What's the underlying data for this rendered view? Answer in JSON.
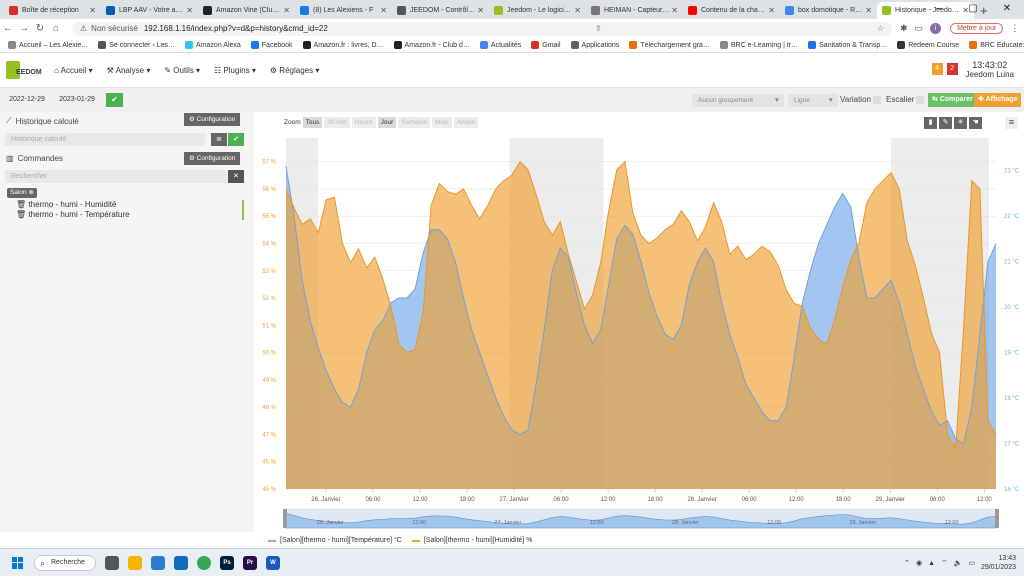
{
  "browser": {
    "tabs": [
      {
        "label": "Boîte de réception",
        "color": "#d93025"
      },
      {
        "label": "LBP AAV - Votre a…",
        "color": "#005eb8"
      },
      {
        "label": "Amazon Vine (Clu…",
        "color": "#222222"
      },
      {
        "label": "(8) Les Alexiens - F",
        "color": "#1877f2"
      },
      {
        "label": "JEEDOM - Contrôl…",
        "color": "#555555"
      },
      {
        "label": "Jeedom - Le logici…",
        "color": "#94c11f"
      },
      {
        "label": "HEIMAN - Capteur…",
        "color": "#777777"
      },
      {
        "label": "Contenu de la cha…",
        "color": "#ff0000"
      },
      {
        "label": "box domotique - R…",
        "color": "#4285f4"
      },
      {
        "label": "Historique - Jeedo…",
        "color": "#94c11f",
        "active": true
      }
    ],
    "address": {
      "warning": "Non sécurisé",
      "url": "192.168.1.16/index.php?v=d&p=history&cmd_id=22"
    },
    "update_label": "Mettre à jour",
    "profile_initial": "i",
    "bookmarks": [
      {
        "label": "Accueil – Les Alexie…",
        "color": "#888888"
      },
      {
        "label": "Se connecter ‹ Les…",
        "color": "#555555"
      },
      {
        "label": "Amazon Alexa",
        "color": "#31c4f3"
      },
      {
        "label": "Facebook",
        "color": "#1877f2"
      },
      {
        "label": "Amazon.fr : livres, D…",
        "color": "#222222"
      },
      {
        "label": "Amazon.fr - Club d…",
        "color": "#222222"
      },
      {
        "label": "Actualités",
        "color": "#4285f4"
      },
      {
        "label": "Gmail",
        "color": "#d93025"
      },
      {
        "label": "Applications",
        "color": "#5f6368"
      },
      {
        "label": "Téléchargement gra…",
        "color": "#e8710a"
      },
      {
        "label": "BRC e-Learning | tr…",
        "color": "#888888"
      },
      {
        "label": "Sanitation & Transp…",
        "color": "#1a73e8"
      },
      {
        "label": "Redeem Course",
        "color": "#333333"
      },
      {
        "label": "BRC Educate: Log in…",
        "color": "#e8710a"
      }
    ]
  },
  "jeedom": {
    "logo_text": "EEDOM",
    "menu": [
      "Accueil",
      "Analyse",
      "Outils",
      "Plugins",
      "Réglages"
    ],
    "badges": [
      {
        "value": "4",
        "color": "#f0a030"
      },
      {
        "value": "2",
        "color": "#d9342b"
      }
    ],
    "time": "13:43:02",
    "name": "Jeedom Luna"
  },
  "toolbar": {
    "date_start": "2022-12-29",
    "date_end": "2023-01-29",
    "grouping": "Aucun groupement",
    "line": "Ligne",
    "variation": "Variation",
    "escalier": "Escalier",
    "compare": "Comparer",
    "affichage": "Affichage"
  },
  "sidebar": {
    "calc_title": "Historique calculé",
    "calc_placeholder": "Historique calculé",
    "config_label": "Configuration",
    "commands_title": "Commandes",
    "search_placeholder": "Rechercher",
    "group": "Salon",
    "commands": [
      "thermo - humi - Humidité",
      "thermo - humi - Température"
    ]
  },
  "chart_zoom": {
    "label": "Zoom",
    "buttons": [
      {
        "label": "Tous",
        "on": true
      },
      {
        "label": "30 min",
        "on": false
      },
      {
        "label": "Heure",
        "on": false
      },
      {
        "label": "Jour",
        "on": true
      },
      {
        "label": "Semaine",
        "on": false
      },
      {
        "label": "Mois",
        "on": false
      },
      {
        "label": "Année",
        "on": false
      }
    ]
  },
  "chart_data": {
    "type": "area",
    "x_ticks": [
      "26. Janvier",
      "06:00",
      "12:00",
      "18:00",
      "27. Janvier",
      "06:00",
      "12:00",
      "18:00",
      "28. Janvier",
      "06:00",
      "12:00",
      "18:00",
      "29. Janvier",
      "06:00",
      "12:00"
    ],
    "navigator_ticks": [
      "26. Janvier",
      "12:00",
      "27. Janvier",
      "12:00",
      "28. Janvier",
      "12:00",
      "29. Janvier",
      "12:00"
    ],
    "y_left_ticks": [
      "45 %",
      "46 %",
      "47 %",
      "48 %",
      "49 %",
      "50 %",
      "51 %",
      "52 %",
      "53 %",
      "54 %",
      "55 %",
      "56 %",
      "57 %"
    ],
    "y_right_ticks": [
      "16 °C",
      "17 °C",
      "18 °C",
      "19 °C",
      "20 °C",
      "21 °C",
      "22 °C",
      "23 °C"
    ],
    "ylim_left": [
      45,
      57.5
    ],
    "ylim_right": [
      16,
      23.5
    ],
    "series": [
      {
        "name": "[Salon][thermo - humi][Température] °C",
        "color": "#7aaee8",
        "axis": "right",
        "x": [
          0,
          1,
          2,
          3,
          4,
          5,
          6,
          7,
          8,
          9,
          10,
          11,
          12,
          13,
          14,
          15,
          16,
          17,
          18,
          19,
          20,
          21,
          22,
          23,
          24,
          25,
          26,
          27,
          28,
          29,
          30,
          31,
          32,
          33,
          34,
          35,
          36,
          37,
          38,
          39,
          40,
          41,
          42,
          43,
          44,
          45,
          46,
          47,
          48,
          49,
          50,
          51,
          52,
          53,
          54,
          55,
          56,
          57,
          58,
          59,
          60,
          61,
          62,
          63,
          64,
          65,
          66,
          67,
          68,
          69,
          70,
          71,
          72,
          73,
          74,
          75,
          76,
          77,
          78,
          79,
          80,
          81,
          82,
          83,
          84,
          85,
          86,
          87,
          88
        ],
        "y": [
          23.1,
          22.0,
          20.6,
          19.7,
          19.1,
          18.6,
          18.2,
          17.9,
          17.8,
          18.2,
          19.0,
          19.5,
          19.7,
          20.1,
          20.2,
          20.2,
          20.4,
          21.2,
          21.7,
          21.7,
          21.5,
          21.0,
          20.2,
          19.5,
          19.0,
          18.5,
          18.0,
          17.6,
          17.3,
          17.2,
          17.3,
          18.3,
          19.5,
          20.8,
          21.3,
          21.1,
          20.3,
          19.6,
          19.2,
          19.5,
          20.5,
          21.5,
          21.8,
          21.6,
          21.0,
          20.3,
          19.8,
          19.4,
          19.3,
          19.6,
          20.5,
          21.0,
          21.3,
          21.0,
          20.1,
          19.4,
          18.9,
          18.3,
          18.0,
          17.7,
          17.5,
          17.5,
          17.8,
          18.9,
          20.1,
          20.8,
          21.4,
          21.8,
          22.2,
          22.5,
          22.2,
          21.1,
          20.2,
          20.2,
          20.4,
          20.6,
          20.1,
          19.4,
          18.7,
          18.2,
          17.7,
          17.4,
          17.5,
          17.1,
          17.0,
          17.8,
          19.4,
          21.0,
          21.4
        ]
      },
      {
        "name": "[Salon][thermo - humi][Humidité] %",
        "color": "#f0a030",
        "axis": "left",
        "x": [
          0,
          1,
          2,
          3,
          4,
          5,
          6,
          7,
          8,
          9,
          10,
          11,
          12,
          13,
          14,
          15,
          16,
          17,
          18,
          19,
          20,
          21,
          22,
          23,
          24,
          25,
          26,
          27,
          28,
          29,
          30,
          31,
          32,
          33,
          34,
          35,
          36,
          37,
          38,
          39,
          40,
          41,
          42,
          43,
          44,
          45,
          46,
          47,
          48,
          49,
          50,
          51,
          52,
          53,
          54,
          55,
          56,
          57,
          58,
          59,
          60,
          61,
          62,
          63,
          64,
          65,
          66,
          67,
          68,
          69,
          70,
          71,
          72,
          73,
          74,
          75,
          76,
          77,
          78,
          79,
          80,
          81,
          82,
          83,
          84,
          85,
          86,
          87,
          88
        ],
        "y": [
          56.0,
          55.3,
          54.7,
          54.9,
          54.4,
          55.6,
          55.7,
          54.0,
          53.3,
          53.8,
          53.1,
          53.5,
          52.7,
          51.7,
          50.3,
          50.0,
          50.1,
          51.5,
          55.4,
          56.2,
          55.9,
          55.8,
          56.0,
          55.4,
          54.9,
          55.4,
          56.0,
          56.3,
          56.5,
          57.0,
          56.7,
          55.8,
          54.8,
          54.3,
          54.8,
          53.6,
          52.6,
          51.6,
          52.1,
          53.3,
          55.2,
          56.7,
          57.0,
          55.1,
          54.3,
          54.0,
          54.2,
          54.5,
          54.7,
          55.2,
          54.8,
          54.1,
          54.6,
          55.5,
          54.8,
          53.6,
          53.9,
          53.4,
          53.6,
          53.9,
          53.7,
          53.2,
          52.3,
          51.8,
          51.7,
          50.9,
          50.5,
          50.3,
          51.2,
          52.4,
          53.4,
          54.0,
          55.5,
          56.0,
          56.3,
          56.6,
          56.0,
          54.1,
          53.2,
          52.0,
          50.7,
          50.0,
          47.0,
          46.5,
          51.0,
          56.3,
          56.0,
          47.5,
          47.0
        ]
      }
    ]
  }
}
